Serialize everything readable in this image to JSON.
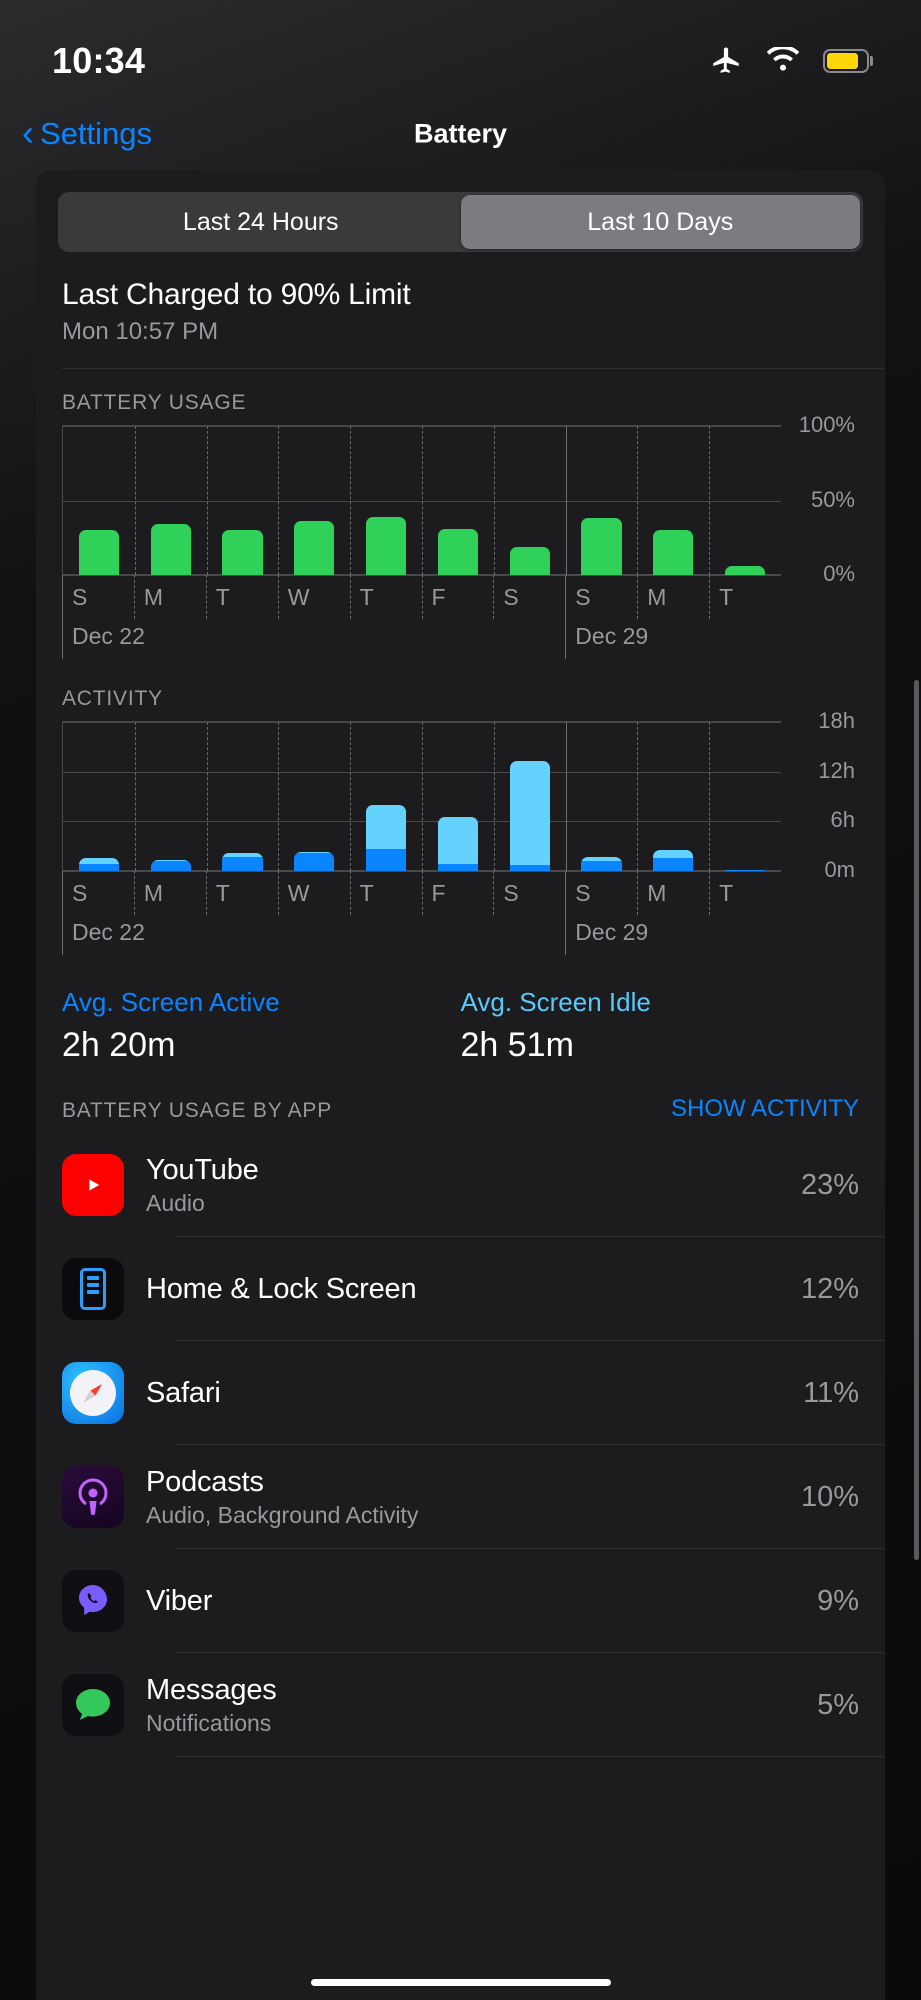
{
  "status_bar": {
    "time": "10:34",
    "icons": [
      "airplane-mode-icon",
      "wifi-icon",
      "battery-icon"
    ],
    "battery_color": "#ffd60a"
  },
  "nav": {
    "back_label": "Settings",
    "back_icon": "chevron-left-icon",
    "title": "Battery"
  },
  "segmented_control": {
    "options": [
      "Last 24 Hours",
      "Last 10 Days"
    ],
    "selected": "Last 10 Days",
    "selected_index": 1
  },
  "charged": {
    "title": "Last Charged to 90% Limit",
    "subtitle": "Mon 10:57 PM"
  },
  "battery_usage_section": {
    "label": "BATTERY USAGE"
  },
  "activity_section": {
    "label": "ACTIVITY"
  },
  "averages": {
    "screen_active_label": "Avg. Screen Active",
    "screen_active_value": "2h 20m",
    "screen_idle_label": "Avg. Screen Idle",
    "screen_idle_value": "2h 51m"
  },
  "apps_section": {
    "title": "BATTERY USAGE BY APP",
    "toggle_label": "SHOW ACTIVITY",
    "rows": [
      {
        "name": "YouTube",
        "subtitle": "Audio",
        "percent": "23%",
        "icon": "youtube-icon"
      },
      {
        "name": "Home & Lock Screen",
        "subtitle": "",
        "percent": "12%",
        "icon": "home-lock-screen-icon"
      },
      {
        "name": "Safari",
        "subtitle": "",
        "percent": "11%",
        "icon": "safari-icon"
      },
      {
        "name": "Podcasts",
        "subtitle": "Audio, Background Activity",
        "percent": "10%",
        "icon": "podcasts-icon"
      },
      {
        "name": "Viber",
        "subtitle": "",
        "percent": "9%",
        "icon": "viber-icon"
      },
      {
        "name": "Messages",
        "subtitle": "Notifications",
        "percent": "5%",
        "icon": "messages-icon"
      }
    ]
  },
  "colors": {
    "accent_blue": "#0a84ff",
    "idle_blue": "#64d2ff",
    "battery_green": "#30d158",
    "card_bg": "#1c1c1e",
    "secondary_text": "#98989d"
  },
  "chart_data": [
    {
      "type": "bar",
      "title": "BATTERY USAGE",
      "categories": [
        "S",
        "M",
        "T",
        "W",
        "T",
        "F",
        "S",
        "S",
        "M",
        "T"
      ],
      "week_labels": [
        "Dec 22",
        "Dec 29"
      ],
      "week_break_after_index": 6,
      "values": [
        30,
        34,
        30,
        36,
        39,
        31,
        19,
        38,
        30,
        6
      ],
      "xlabel": "",
      "ylabel": "%",
      "ylim": [
        0,
        100
      ],
      "ytick_values": [
        0,
        50,
        100
      ],
      "ytick_labels": [
        "0%",
        "50%",
        "100%"
      ],
      "grid": true,
      "series_color": "#30d158"
    },
    {
      "type": "bar",
      "title": "ACTIVITY",
      "stacked": true,
      "categories": [
        "S",
        "M",
        "T",
        "W",
        "T",
        "F",
        "S",
        "S",
        "M",
        "T"
      ],
      "week_labels": [
        "Dec 22",
        "Dec 29"
      ],
      "week_break_after_index": 6,
      "series": [
        {
          "name": "Screen Active",
          "color": "#0a84ff",
          "values": [
            0.9,
            1.2,
            1.7,
            2.2,
            2.6,
            0.8,
            0.7,
            1.2,
            1.6,
            0.05
          ]
        },
        {
          "name": "Screen Idle",
          "color": "#64d2ff",
          "values": [
            0.7,
            0.1,
            0.5,
            0.1,
            5.4,
            5.7,
            12.6,
            0.5,
            0.9,
            0.0
          ]
        }
      ],
      "xlabel": "",
      "ylabel": "hours",
      "ylim": [
        0,
        18
      ],
      "ytick_values": [
        0,
        6,
        12,
        18
      ],
      "ytick_labels": [
        "0m",
        "6h",
        "12h",
        "18h"
      ],
      "grid": true
    }
  ]
}
